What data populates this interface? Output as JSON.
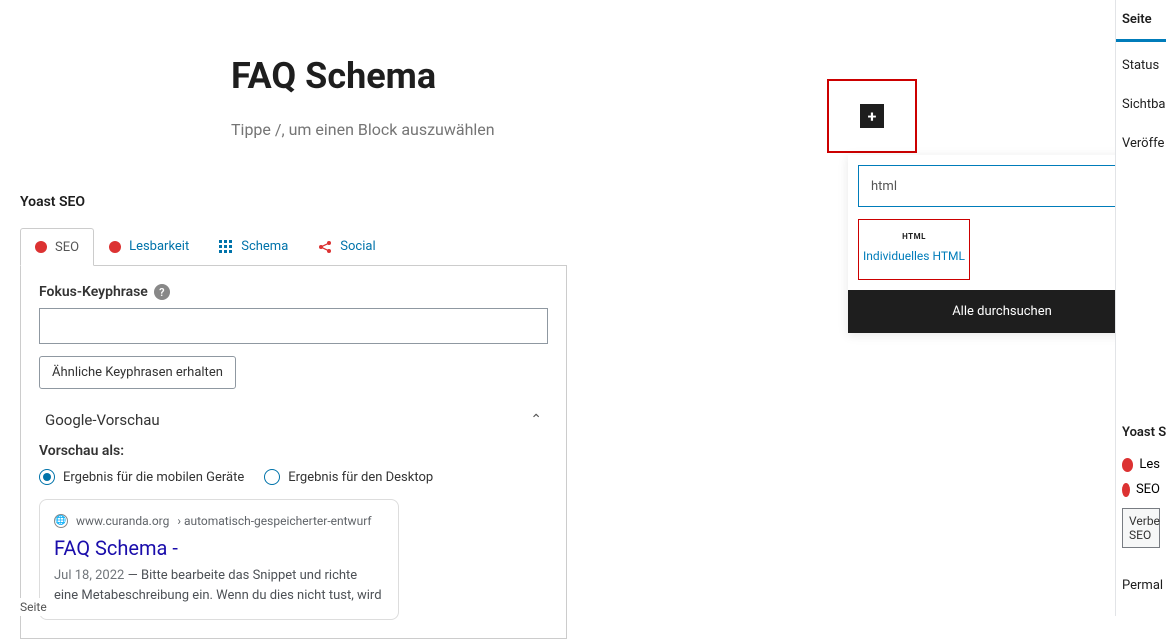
{
  "editor": {
    "title": "FAQ Schema",
    "prompt": "Tippe /, um einen Block auszuwählen"
  },
  "block_inserter": {
    "search_value": "html",
    "result_icon_text": "HTML",
    "result_label": "Individuelles HTML",
    "browse_all": "Alle durchsuchen"
  },
  "yoast": {
    "panel_title": "Yoast SEO",
    "tabs": {
      "seo": "SEO",
      "readability": "Lesbarkeit",
      "schema": "Schema",
      "social": "Social"
    },
    "focus_keyphrase_label": "Fokus-Keyphrase",
    "related_keyphrases_btn": "Ähnliche Keyphrasen erhalten",
    "google_preview_header": "Google-Vorschau",
    "preview_as_label": "Vorschau als:",
    "radio_mobile": "Ergebnis für die mobilen Geräte",
    "radio_desktop": "Ergebnis für den Desktop",
    "serp": {
      "domain": "www.curanda.org",
      "path": "› automatisch-gespeicherter-entwurf",
      "title": "FAQ Schema -",
      "date": "Jul 18, 2022",
      "desc_prefix": " — ",
      "desc": "Bitte bearbeite das Snippet und richte eine Metabeschreibung ein. Wenn du dies nicht tust, wird"
    }
  },
  "sidebar": {
    "tab_page": "Seite",
    "status": "Status",
    "visibility": "Sichtba",
    "publish": "Veröffe",
    "yoast_heading": "Yoast S",
    "readability": "Les",
    "seo": "SEO",
    "improve_btn_line1": "Verbe",
    "improve_btn_line2": "SEO",
    "permalink": "Permal"
  },
  "footer": "Seite"
}
